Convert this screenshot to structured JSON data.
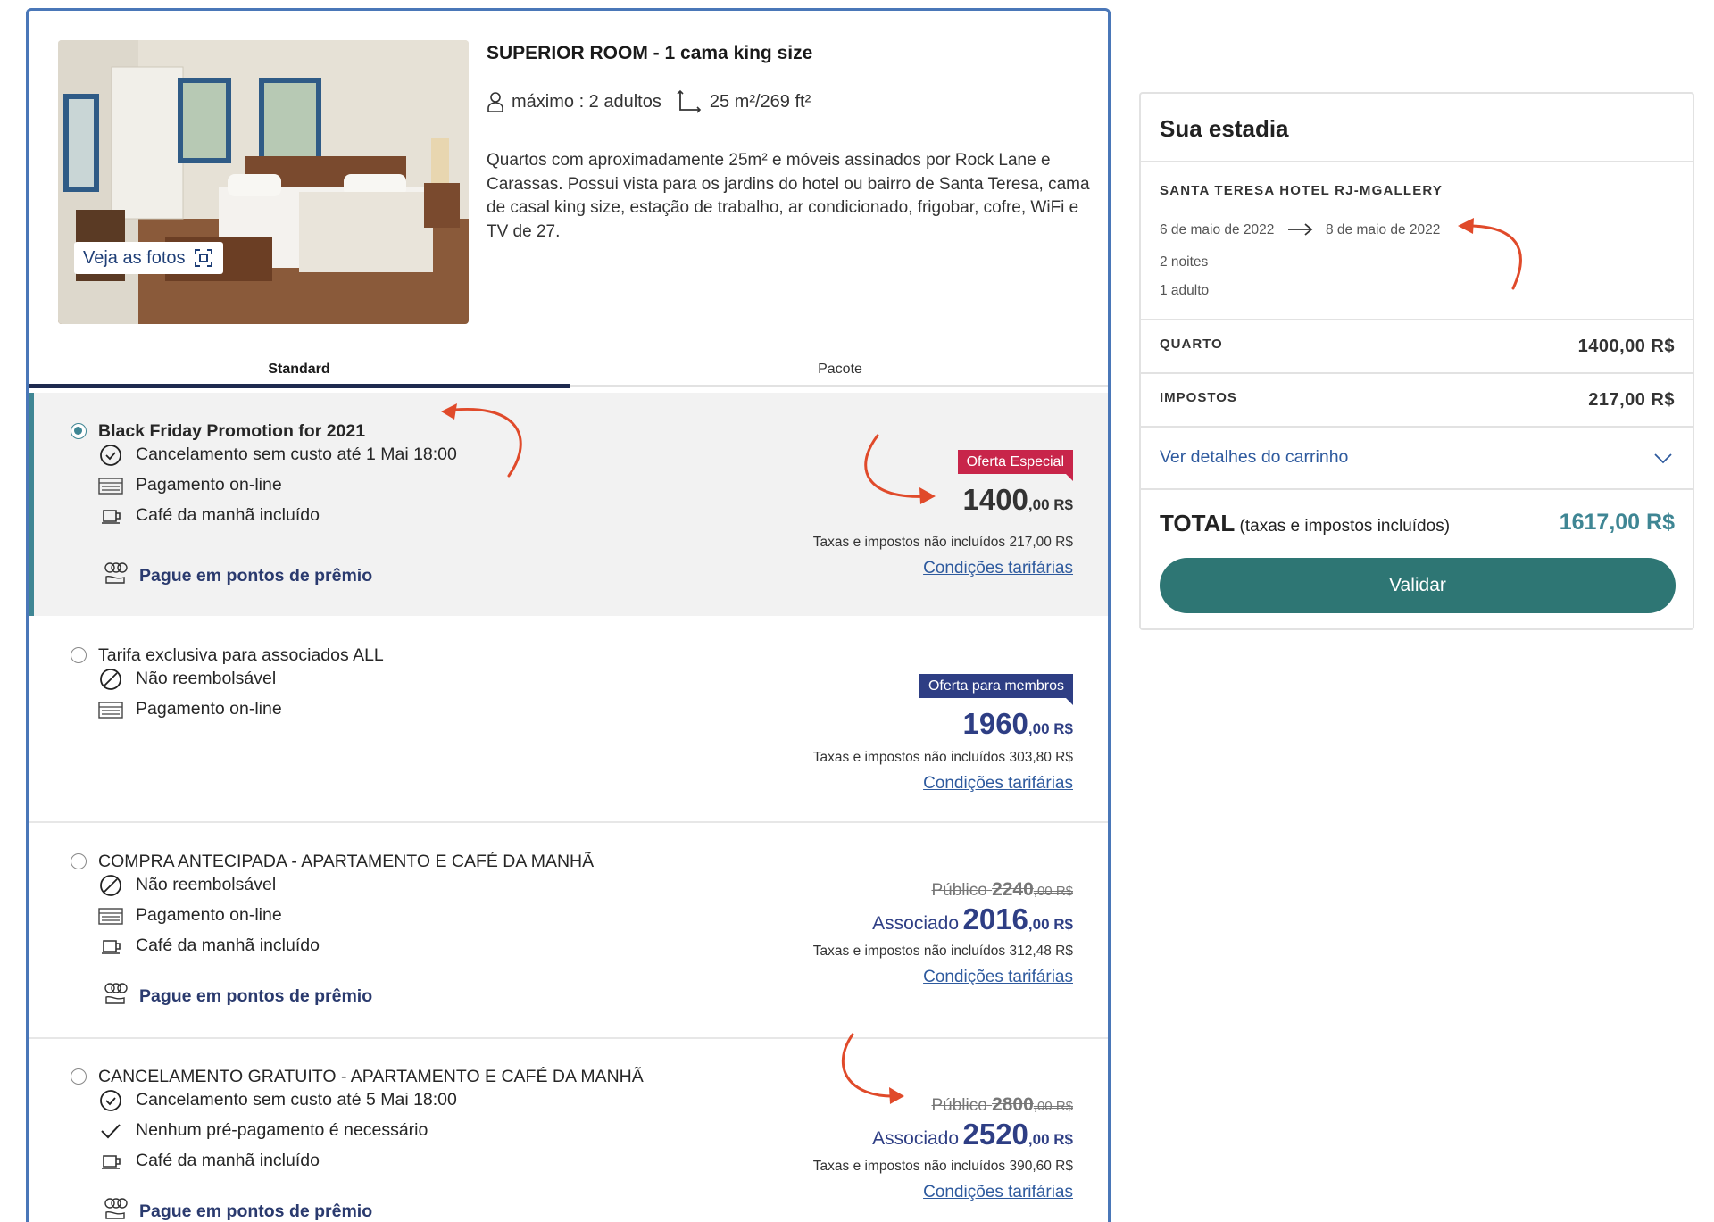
{
  "room": {
    "title": "SUPERIOR ROOM - 1 cama king size",
    "capacity": "máximo : 2 adultos",
    "size": "25 m²/269 ft²",
    "description": "Quartos com aproximadamente 25m² e móveis assinados por Rock Lane e Carassas. Possui vista para os jardins do hotel ou bairro de Santa Teresa, cama de casal king size, estação de trabalho, ar condicionado, frigobar, cofre, WiFi e TV de 27.",
    "photos_button": "Veja as fotos"
  },
  "tabs": [
    {
      "label": "Standard",
      "active": true
    },
    {
      "label": "Pacote",
      "active": false
    }
  ],
  "rates": [
    {
      "name": "Black Friday Promotion for 2021",
      "selected": true,
      "features": [
        {
          "icon": "clock-check-icon",
          "text": "Cancelamento sem custo até 1 Mai 18:00"
        },
        {
          "icon": "credit-card-icon",
          "text": "Pagamento on-line"
        },
        {
          "icon": "coffee-cup-icon",
          "text": "Café da manhã incluído"
        }
      ],
      "points_link": "Pague em pontos de prêmio",
      "badge": "Oferta Especial",
      "price_int": "1400",
      "price_dec": ",00 R$",
      "tax": "Taxas e impostos não incluídos 217,00 R$",
      "conditions": "Condições tarifárias"
    },
    {
      "name": "Tarifa exclusiva para associados ALL",
      "selected": false,
      "features": [
        {
          "icon": "no-refund-icon",
          "text": "Não reembolsável"
        },
        {
          "icon": "credit-card-icon",
          "text": "Pagamento on-line"
        }
      ],
      "badge": "Oferta para membros",
      "price_int": "1960",
      "price_dec": ",00 R$",
      "tax": "Taxas e impostos não incluídos 303,80 R$",
      "conditions": "Condições tarifárias"
    },
    {
      "name": "COMPRA ANTECIPADA - APARTAMENTO E CAFÉ DA MANHÃ",
      "selected": false,
      "features": [
        {
          "icon": "no-refund-icon",
          "text": "Não reembolsável"
        },
        {
          "icon": "credit-card-icon",
          "text": "Pagamento on-line"
        },
        {
          "icon": "coffee-cup-icon",
          "text": "Café da manhã incluído"
        }
      ],
      "points_link": "Pague em pontos de prêmio",
      "public_label": "Público",
      "public_int": "2240",
      "public_dec": ",00 R$",
      "member_label": "Associado",
      "price_int": "2016",
      "price_dec": ",00 R$",
      "tax": "Taxas e impostos não incluídos 312,48 R$",
      "conditions": "Condições tarifárias"
    },
    {
      "name": "CANCELAMENTO GRATUITO - APARTAMENTO E CAFÉ DA MANHÃ",
      "selected": false,
      "features": [
        {
          "icon": "clock-check-icon",
          "text": "Cancelamento sem custo até 5 Mai 18:00"
        },
        {
          "icon": "checkmark-icon",
          "text": "Nenhum pré-pagamento é necessário"
        },
        {
          "icon": "coffee-cup-icon",
          "text": "Café da manhã incluído"
        }
      ],
      "points_link": "Pague em pontos de prêmio",
      "public_label": "Público",
      "public_int": "2800",
      "public_dec": ",00 R$",
      "member_label": "Associado",
      "price_int": "2520",
      "price_dec": ",00 R$",
      "tax": "Taxas e impostos não incluídos 390,60 R$",
      "conditions": "Condições tarifárias"
    }
  ],
  "stay": {
    "title": "Sua estadia",
    "hotel": "SANTA TERESA HOTEL RJ-MGALLERY",
    "check_in": "6 de maio de 2022",
    "check_out": "8 de maio de 2022",
    "nights": "2 noites",
    "guests": "1 adulto",
    "room_label": "QUARTO",
    "room_amount": "1400,00 R$",
    "tax_label": "IMPOSTOS",
    "tax_amount": "217,00 R$",
    "cart_link": "Ver detalhes do carrinho",
    "total_label": "TOTAL",
    "total_note": "(taxas e impostos incluídos)",
    "total_amount": "1617,00 R$",
    "validate_button": "Validar"
  },
  "colors": {
    "accent_teal": "#3f8694",
    "button_teal": "#2e7674",
    "badge_red": "#c8254a",
    "badge_blue": "#2e3e84",
    "link_blue": "#2e5a9e",
    "annotation_arrow": "#e04a2a"
  }
}
